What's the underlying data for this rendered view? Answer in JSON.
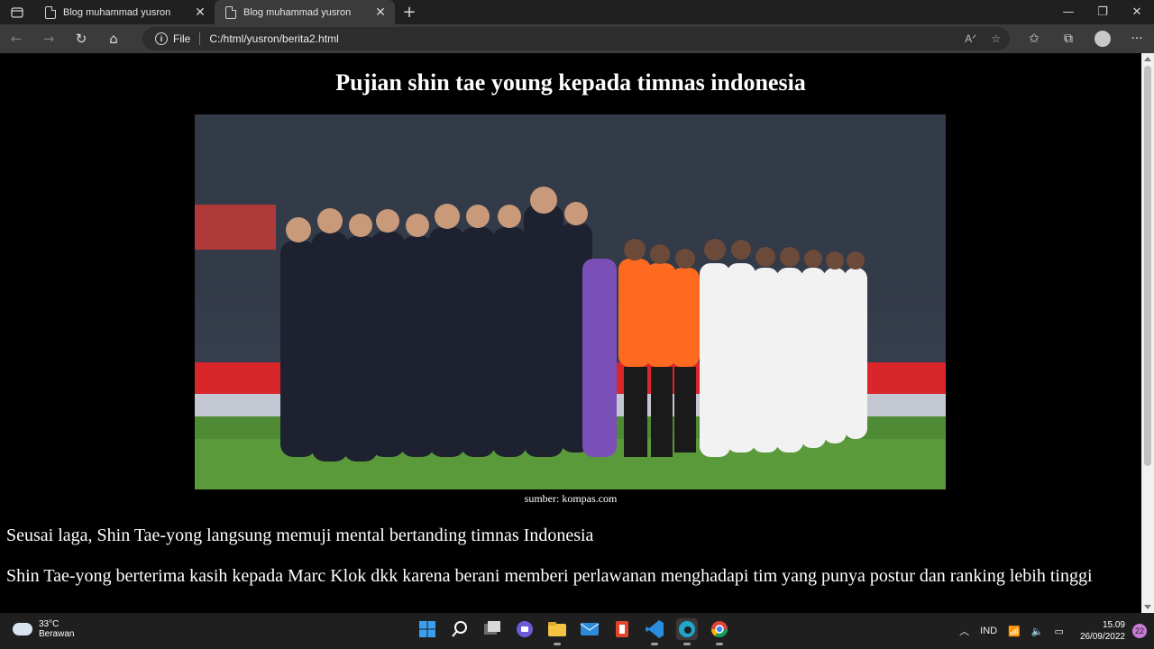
{
  "browser": {
    "tabs": [
      {
        "title": "Blog muhammad yusron",
        "close": "✕"
      },
      {
        "title": "Blog muhammad yusron",
        "close": "✕"
      }
    ],
    "file_label": "File",
    "url": "C:/html/yusron/berita2.html"
  },
  "page": {
    "heading": "Pujian shin tae young kepada timnas indonesia",
    "caption": "sumber: kompas.com",
    "paragraph1": "Seusai laga, Shin Tae-yong langsung memuji mental bertanding timnas Indonesia",
    "paragraph2": "Shin Tae-yong berterima kasih kepada Marc Klok dkk karena berani memberi perlawanan menghadapi tim yang punya postur dan ranking lebih tinggi"
  },
  "taskbar": {
    "temperature": "33°C",
    "weather": "Berawan",
    "language": "IND",
    "time": "15.09",
    "date": "26/09/2022",
    "notifications": "22"
  },
  "colors": {
    "page_bg": "#000000",
    "text": "#ffffff",
    "navbar": "#3b3b3b",
    "tabbar": "#202020"
  }
}
